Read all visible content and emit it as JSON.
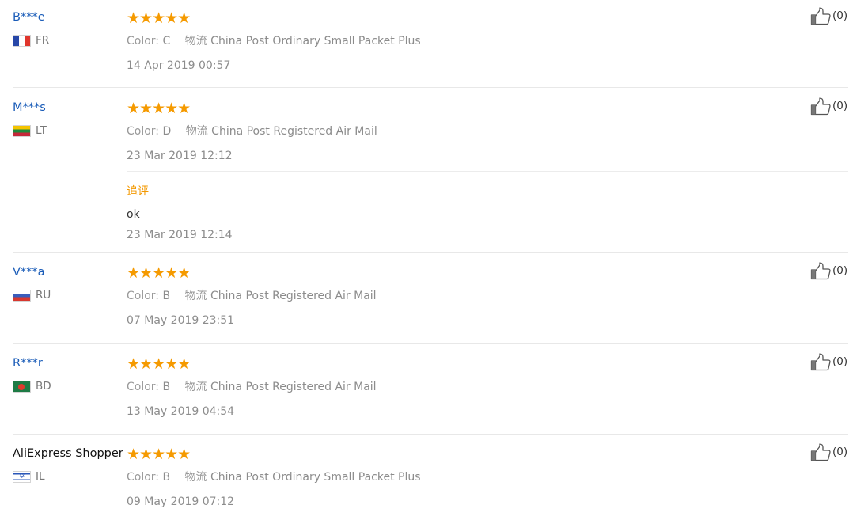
{
  "reviews": [
    {
      "user": "B***e",
      "country": "FR",
      "stars": "★★★★★",
      "color_label": "Color:",
      "color_value": "C",
      "logistics_label": "物流",
      "logistics_value": "China Post Ordinary Small Packet Plus",
      "date": "14 Apr 2019 00:57",
      "helpful": "(0)"
    },
    {
      "user": "M***s",
      "country": "LT",
      "stars": "★★★★★",
      "color_label": "Color:",
      "color_value": "D",
      "logistics_label": "物流",
      "logistics_value": "China Post Registered Air Mail",
      "date": "23 Mar 2019 12:12",
      "helpful": "(0)",
      "followup": {
        "label": "追评",
        "text": "ok",
        "date": "23 Mar 2019 12:14"
      }
    },
    {
      "user": "V***a",
      "country": "RU",
      "stars": "★★★★★",
      "color_label": "Color:",
      "color_value": "B",
      "logistics_label": "物流",
      "logistics_value": "China Post Registered Air Mail",
      "date": "07 May 2019 23:51",
      "helpful": "(0)"
    },
    {
      "user": "R***r",
      "country": "BD",
      "stars": "★★★★★",
      "color_label": "Color:",
      "color_value": "B",
      "logistics_label": "物流",
      "logistics_value": "China Post Registered Air Mail",
      "date": "13 May 2019 04:54",
      "helpful": "(0)"
    },
    {
      "user": "AliExpress Shopper",
      "country": "IL",
      "stars": "★★★★★",
      "color_label": "Color:",
      "color_value": "B",
      "logistics_label": "物流",
      "logistics_value": "China Post Ordinary Small Packet Plus",
      "date": "09 May 2019 07:12",
      "helpful": "(0)"
    }
  ],
  "rating": {
    "stars_per_review": 5,
    "out_of": 5
  },
  "colors": {
    "star": "#f59a00",
    "user_link": "#1a5cb8",
    "followup_label": "#f39800",
    "meta_text": "#8c8c8c"
  },
  "icons": {
    "thumbs_up": "thumbs-up-icon",
    "star": "star-icon",
    "flags": [
      "flag-fr-icon",
      "flag-lt-icon",
      "flag-ru-icon",
      "flag-bd-icon",
      "flag-il-icon"
    ]
  }
}
